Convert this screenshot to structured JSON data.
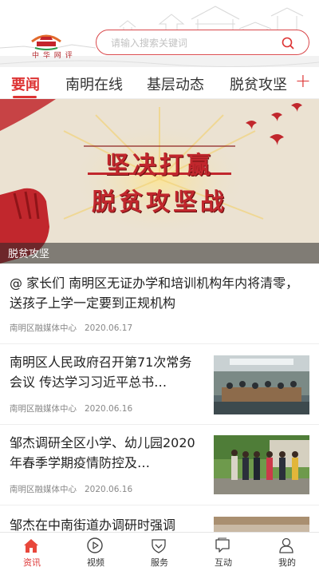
{
  "header": {
    "logo_text": "中 华 网 评",
    "search_placeholder": "请输入搜索关键词"
  },
  "tabs": [
    {
      "label": "要闻",
      "active": true
    },
    {
      "label": "南明在线",
      "active": false
    },
    {
      "label": "基层动态",
      "active": false
    },
    {
      "label": "脱贫攻坚",
      "active": false
    }
  ],
  "banner": {
    "headline_line1": "坚决打赢",
    "headline_line2": "脱贫攻坚战",
    "caption": "脱贫攻坚"
  },
  "news": [
    {
      "title": "@ 家长们 南明区无证办学和培训机构年内将清零，送孩子上学一定要到正规机构",
      "source": "南明区融媒体中心",
      "date": "2020.06.17"
    },
    {
      "title": "南明区人民政府召开第71次常务会议 传达学习习近平总书…",
      "source": "南明区融媒体中心",
      "date": "2020.06.16"
    },
    {
      "title": "邹杰调研全区小学、幼儿园2020年春季学期疫情防控及…",
      "source": "南明区融媒体中心",
      "date": "2020.06.16"
    },
    {
      "title": "邹杰在中南街道办调研时强调",
      "source": "",
      "date": ""
    }
  ],
  "bottom_nav": [
    {
      "label": "资讯",
      "icon": "home-icon",
      "active": true
    },
    {
      "label": "视频",
      "icon": "play-icon",
      "active": false
    },
    {
      "label": "服务",
      "icon": "heart-icon",
      "active": false
    },
    {
      "label": "互动",
      "icon": "chat-icon",
      "active": false
    },
    {
      "label": "我的",
      "icon": "user-icon",
      "active": false
    }
  ],
  "colors": {
    "accent": "#dd3333",
    "banner_red": "#c1272d",
    "banner_yellow": "#f3c948"
  }
}
